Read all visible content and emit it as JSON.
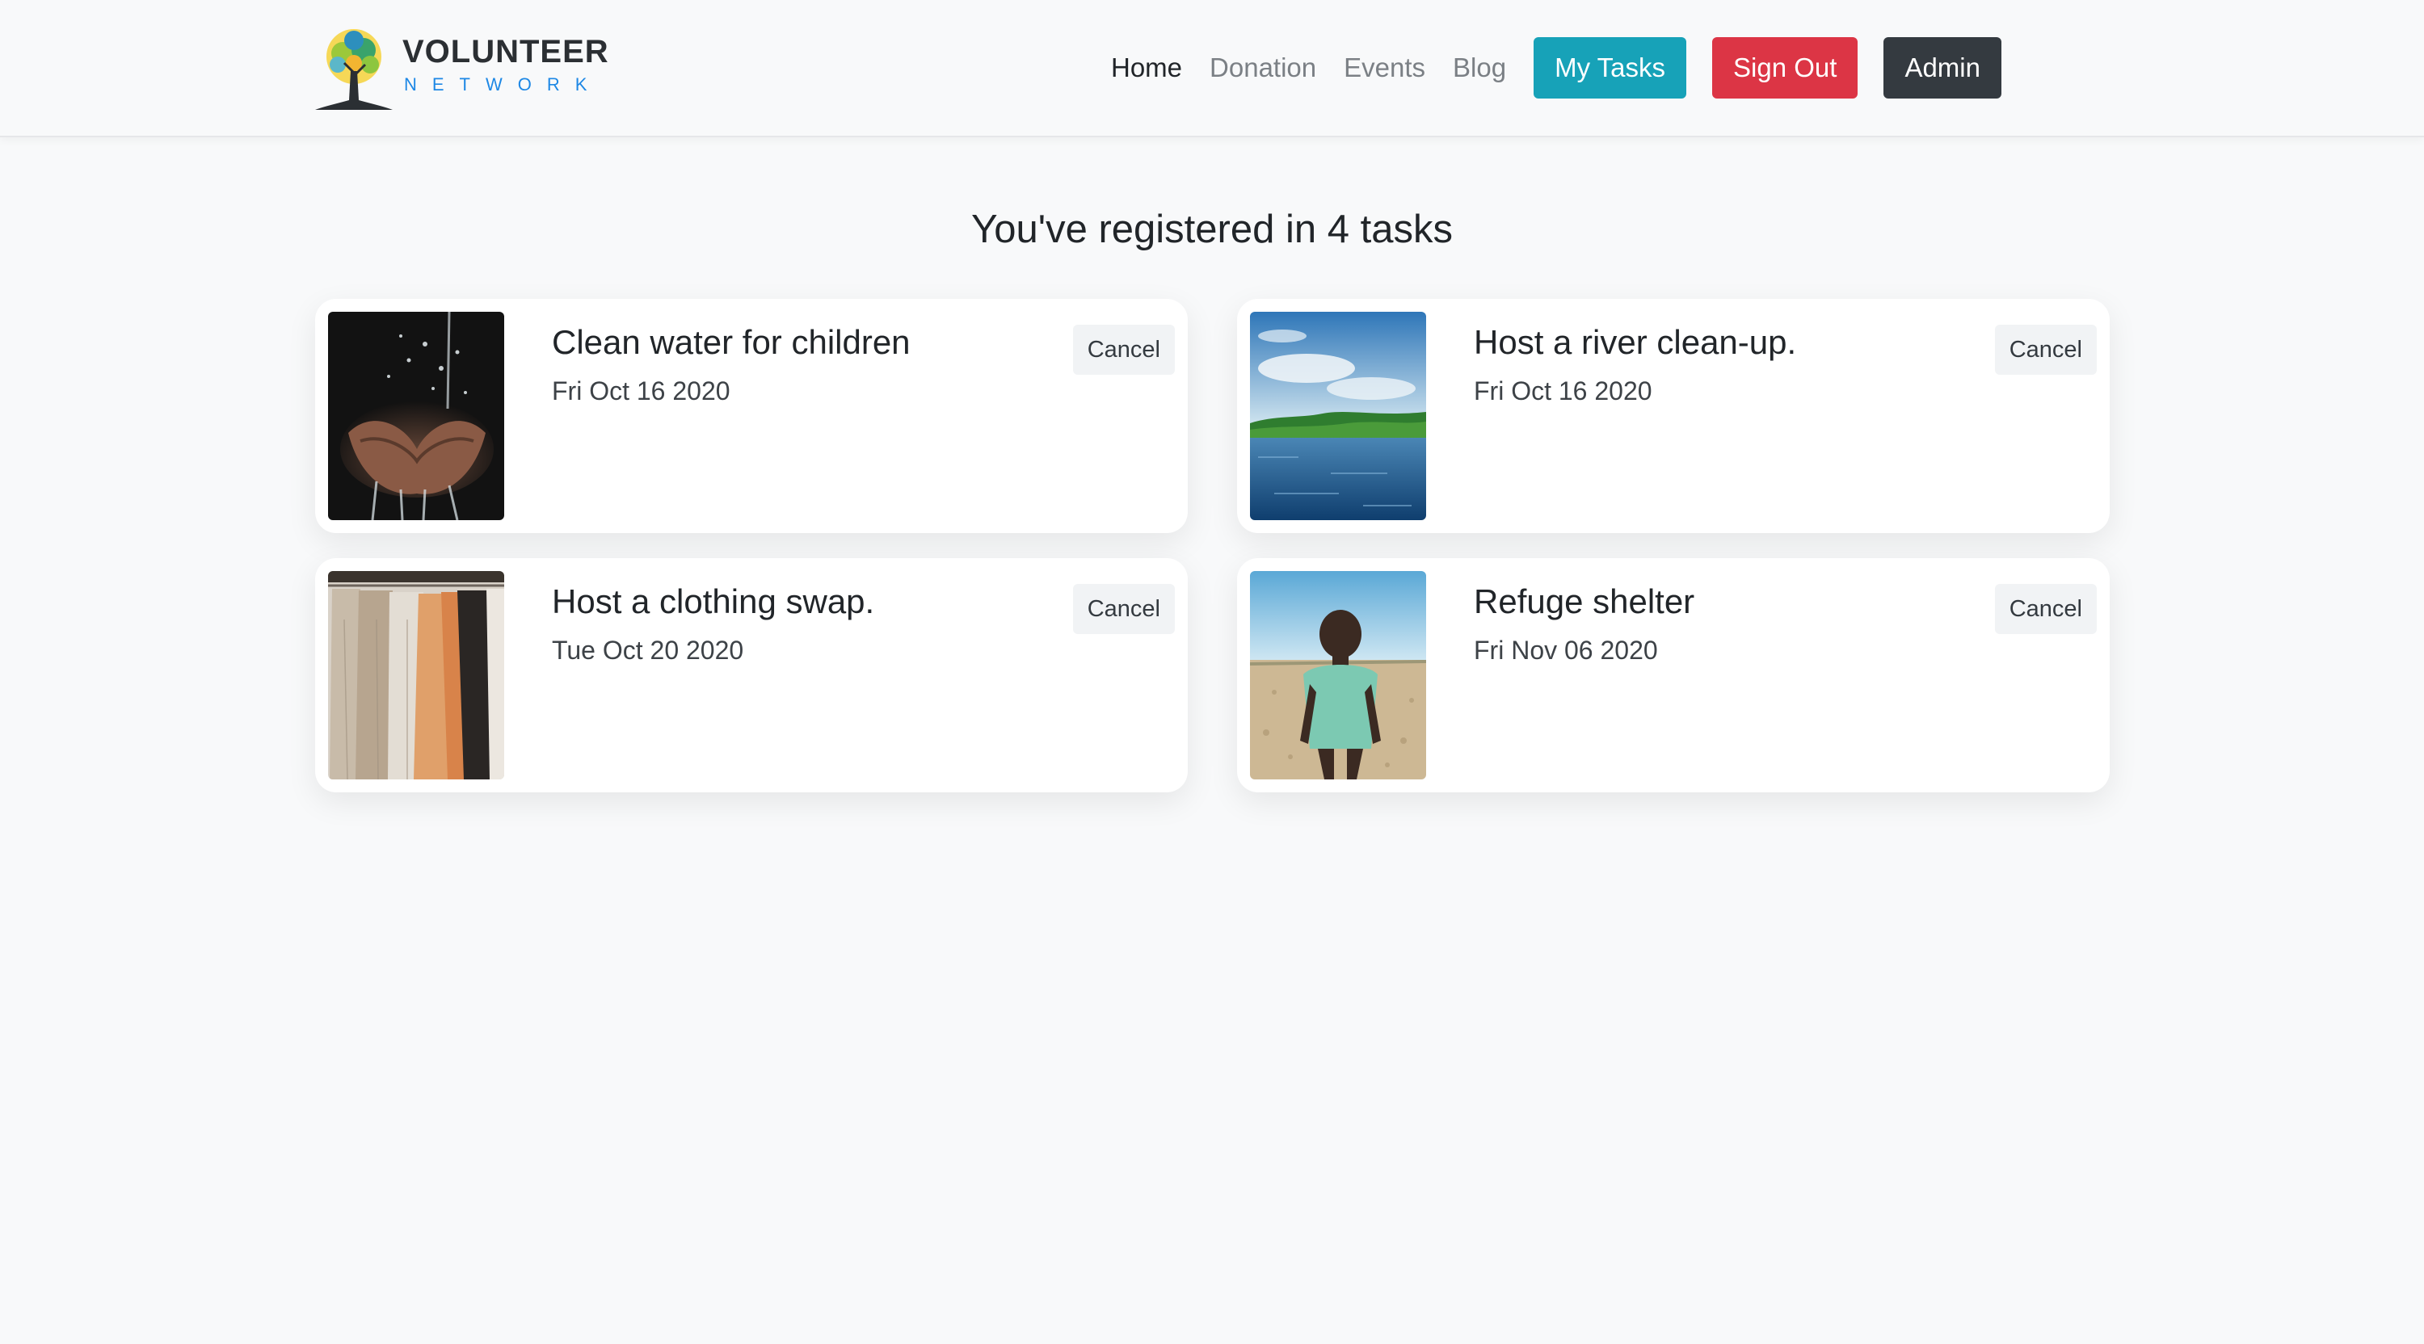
{
  "brand": {
    "title": "VOLUNTEER",
    "subtitle": "NETWORK"
  },
  "nav": {
    "links": [
      "Home",
      "Donation",
      "Events",
      "Blog"
    ],
    "active": "Home",
    "buttons": {
      "my_tasks": "My Tasks",
      "sign_out": "Sign Out",
      "admin": "Admin"
    },
    "colors": {
      "my_tasks": "#17a2b8",
      "sign_out": "#dc3545",
      "admin": "#343a40"
    }
  },
  "main": {
    "heading": "You've registered in 4 tasks",
    "tasks": [
      {
        "title": "Clean water for children",
        "date": "Fri Oct 16 2020",
        "cancel_label": "Cancel",
        "image": "hands-water-photo"
      },
      {
        "title": "Host a river clean-up.",
        "date": "Fri Oct 16 2020",
        "cancel_label": "Cancel",
        "image": "river-landscape-photo"
      },
      {
        "title": "Host a clothing swap.",
        "date": "Tue Oct 20 2020",
        "cancel_label": "Cancel",
        "image": "clothing-rack-photo"
      },
      {
        "title": "Refuge shelter",
        "date": "Fri Nov 06 2020",
        "cancel_label": "Cancel",
        "image": "child-portrait-photo"
      }
    ]
  }
}
